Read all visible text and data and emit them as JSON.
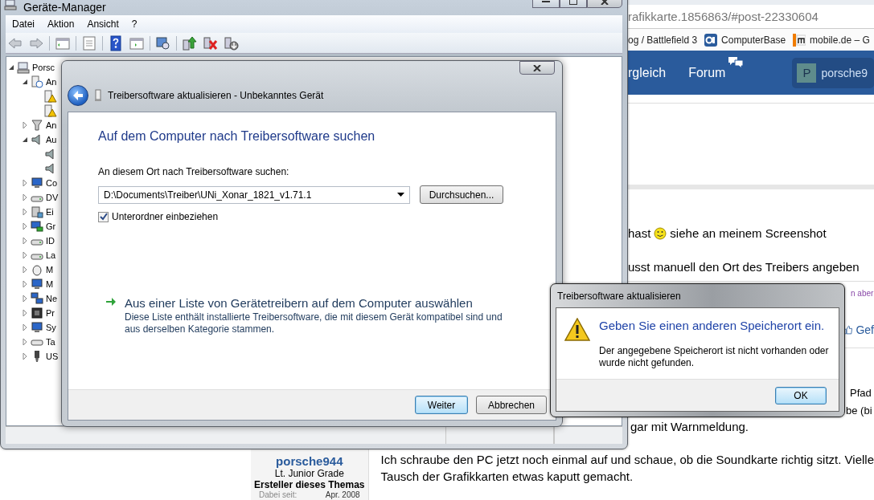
{
  "browser": {
    "url": "rafikkarte.1856863/#post-22330604",
    "bookmarks": [
      {
        "label": "og / Battlefield 3"
      },
      {
        "label": "ComputerBase",
        "kind": "cb"
      },
      {
        "label": "mobile.de – G",
        "kind": "m"
      }
    ],
    "nav": [
      {
        "label": "rgleich",
        "kind": "plain"
      },
      {
        "label": "Forum",
        "kind": "chat"
      }
    ],
    "user": {
      "initial": "P",
      "name": "porsche9"
    },
    "post_a": {
      "before": "hast",
      "after": "siehe an meinem Screenshot",
      "line2": "usst manuell den Ort des Treibers angeben",
      "note": "n aber",
      "like": "Gef"
    },
    "post_b": [
      "Pfad",
      "be (bi",
      "gar mit Warnmeldung."
    ],
    "author": {
      "name": "porsche944",
      "rank": "Lt. Junior Grade",
      "role": "Ersteller dieses Themas",
      "since_label": "Dabei seit:",
      "since": "Apr. 2008"
    },
    "post_c": [
      "Ich schraube den PC jetzt noch einmal auf und schaue, ob die Soundkarte richtig sitzt. Vielle",
      "Tausch der Grafikkarten etwas kaputt gemacht."
    ]
  },
  "device_manager": {
    "title": "Geräte-Manager",
    "menu": [
      "Datei",
      "Aktion",
      "Ansicht",
      "?"
    ],
    "tree": [
      {
        "label": "Porsc",
        "kind": "computer",
        "expanded": true,
        "children": [
          {
            "label": "An",
            "kind": "unknown",
            "expanded": true,
            "children": [
              {
                "kind": "warning"
              },
              {
                "kind": "warning"
              }
            ]
          },
          {
            "label": "An",
            "kind": "port",
            "expanded": false
          },
          {
            "label": "Au",
            "kind": "speaker",
            "expanded": true,
            "children": [
              {
                "kind": "speaker"
              },
              {
                "kind": "speaker"
              }
            ]
          },
          {
            "label": "Co",
            "kind": "monitor",
            "expanded": false
          },
          {
            "label": "DV",
            "kind": "drive",
            "expanded": false
          },
          {
            "label": "Ei",
            "kind": "controller",
            "expanded": false
          },
          {
            "label": "Gr",
            "kind": "adapter",
            "expanded": false
          },
          {
            "label": "ID",
            "kind": "drive",
            "expanded": false
          },
          {
            "label": "La",
            "kind": "drive",
            "expanded": false
          },
          {
            "label": "M",
            "kind": "mouse",
            "expanded": false
          },
          {
            "label": "M",
            "kind": "monitor",
            "expanded": false
          },
          {
            "label": "Ne",
            "kind": "network",
            "expanded": false
          },
          {
            "label": "Pr",
            "kind": "cpu",
            "expanded": false
          },
          {
            "label": "Sy",
            "kind": "monitor",
            "expanded": false
          },
          {
            "label": "Ta",
            "kind": "keyboard",
            "expanded": false
          },
          {
            "label": "US",
            "kind": "usb",
            "expanded": false
          }
        ]
      }
    ]
  },
  "driver_dialog": {
    "title": "Treibersoftware aktualisieren - Unbekanntes Gerät",
    "heading": "Auf dem Computer nach Treibersoftware suchen",
    "path_label": "An diesem Ort nach Treibersoftware suchen:",
    "path_value": "D:\\Documents\\Treiber\\UNi_Xonar_1821_v1.71.1",
    "browse": "Durchsuchen...",
    "subfolders": {
      "label": "Unterordner einbeziehen",
      "checked": true
    },
    "link": "Aus einer Liste von Gerätetreibern auf dem Computer auswählen",
    "link_description": "Diese Liste enthält installierte Treibersoftware, die mit diesem Gerät kompatibel sind und aus derselben Kategorie stammen.",
    "buttons": [
      {
        "label": "Weiter",
        "default": true
      },
      {
        "label": "Abbrechen",
        "default": false
      }
    ]
  },
  "message_box": {
    "title": "Treibersoftware aktualisieren",
    "heading": "Geben Sie einen anderen Speicherort ein.",
    "text": "Der angegebene Speicherort ist nicht vorhanden oder wurde nicht gefunden.",
    "buttons": [
      {
        "label": "OK",
        "default": true
      }
    ]
  }
}
